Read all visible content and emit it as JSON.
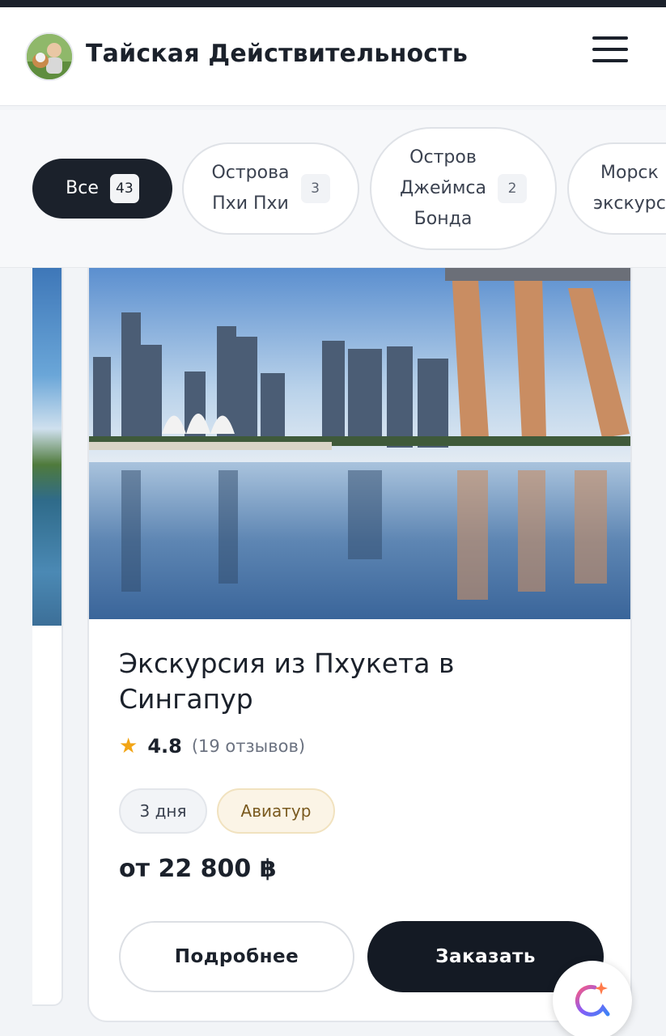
{
  "header": {
    "site_title": "Тайская Действительность"
  },
  "filters": [
    {
      "label": "Все",
      "count": "43",
      "active": true
    },
    {
      "label": "Острова\nПхи Пхи",
      "count": "3",
      "active": false
    },
    {
      "label": "Остров\nДжеймса\nБонда",
      "count": "2",
      "active": false
    },
    {
      "label": "Морск\nэкскурс",
      "count": "",
      "active": false
    }
  ],
  "card": {
    "title": "Экскурсия из Пхукета в Сингапур",
    "rating": "4.8",
    "reviews": "(19 отзывов)",
    "duration": "3 дня",
    "operator": "Авиатур",
    "price": "от 22 800 ฿",
    "details_label": "Подробнее",
    "order_label": "Заказать"
  },
  "icons": {
    "star": "star-icon",
    "menu": "menu-icon",
    "chat": "chat-assistant-icon"
  },
  "colors": {
    "dark": "#1b212b",
    "star": "#f2a516",
    "operator_tag_bg": "#fbf4e6"
  }
}
